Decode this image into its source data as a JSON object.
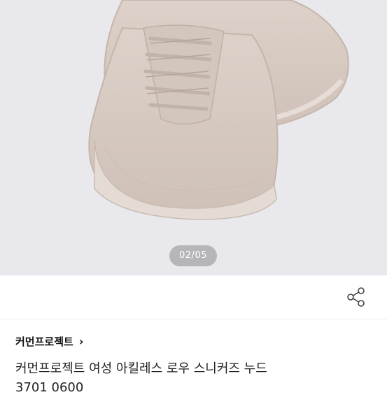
{
  "gallery": {
    "counter": "02/05",
    "image_alt": "nude low sneakers product photo"
  },
  "share": {
    "icon": "share-icon"
  },
  "brand": {
    "name": "커먼프로젝트",
    "chevron": "›"
  },
  "product": {
    "title_line1": "커먼프로젝트 여성 아킬레스 로우 스니커즈 누드",
    "title_line2": "3701 0600"
  },
  "colors": {
    "background": "#e9e8ec",
    "shoe": "#d9ccc4",
    "sole": "#e2d8d0"
  }
}
